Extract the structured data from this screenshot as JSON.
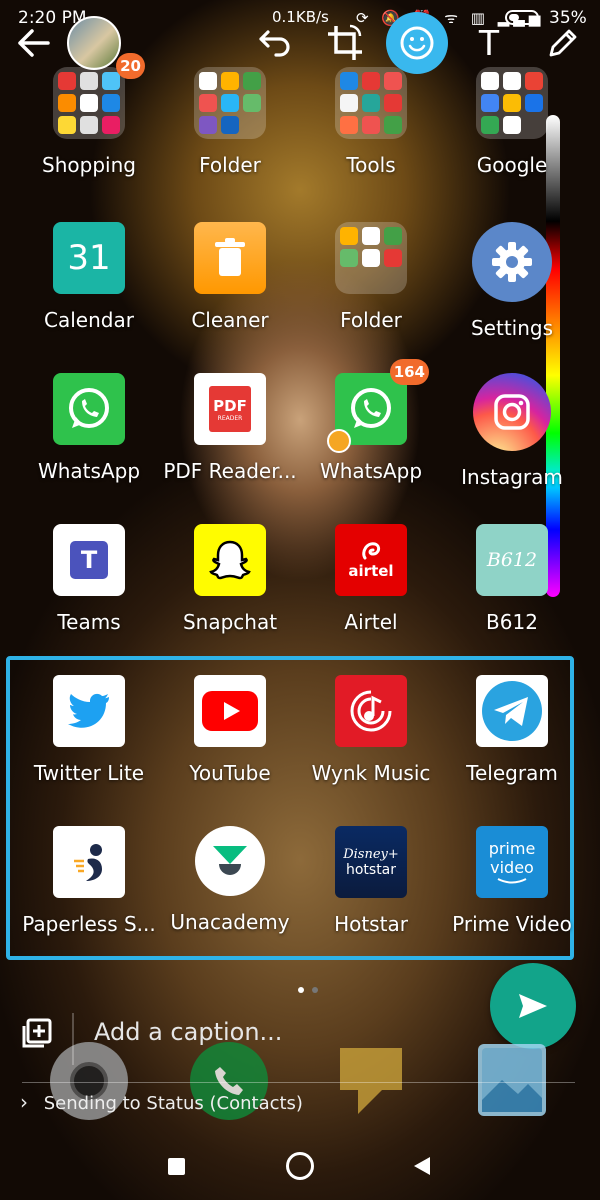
{
  "status_bar": {
    "time": "2:20 PM",
    "net_speed": "0.1KB/s",
    "battery": "35%",
    "icons": [
      "rotate-icon",
      "mute-icon",
      "alarm-icon",
      "wifi-icon",
      "volte-icon",
      "signal-icon"
    ]
  },
  "toolbar": {
    "back": "back-arrow-icon",
    "undo": "undo-icon",
    "crop": "crop-rotate-icon",
    "emoji": "emoji-icon",
    "text": "T",
    "draw": "pencil-icon",
    "emoji_color": "#39b8ee"
  },
  "apps": [
    {
      "label": "Shopping",
      "type": "folder",
      "badge": "20"
    },
    {
      "label": "Folder",
      "type": "folder"
    },
    {
      "label": "Tools",
      "type": "folder"
    },
    {
      "label": "Google",
      "type": "folder"
    },
    {
      "label": "Calendar",
      "icon_text": "31"
    },
    {
      "label": "Cleaner"
    },
    {
      "label": "Folder",
      "type": "folder"
    },
    {
      "label": "Settings"
    },
    {
      "label": "WhatsApp"
    },
    {
      "label": "PDF Reader...",
      "icon_text": "PDF",
      "icon_subtext": "READER"
    },
    {
      "label": "WhatsApp",
      "badge": "164"
    },
    {
      "label": "Instagram"
    },
    {
      "label": "Teams",
      "icon_text": "T"
    },
    {
      "label": "Snapchat"
    },
    {
      "label": "Airtel",
      "icon_text": "airtel"
    },
    {
      "label": "B612",
      "icon_text": "B612"
    },
    {
      "label": "Twitter Lite"
    },
    {
      "label": "YouTube"
    },
    {
      "label": "Wynk Music"
    },
    {
      "label": "Telegram"
    },
    {
      "label": "Paperless S..."
    },
    {
      "label": "Unacademy"
    },
    {
      "label": "Hotstar",
      "icon_text": "Disney+",
      "icon_subtext": "hotstar"
    },
    {
      "label": "Prime Video",
      "icon_text": "prime",
      "icon_subtext": "video"
    }
  ],
  "caption": {
    "placeholder": "Add a caption..."
  },
  "status_recipient": "Sending to Status (Contacts)",
  "colors": {
    "accent": "#12a48a",
    "selection": "#2fb3e8",
    "badge": "#f16b2c"
  }
}
